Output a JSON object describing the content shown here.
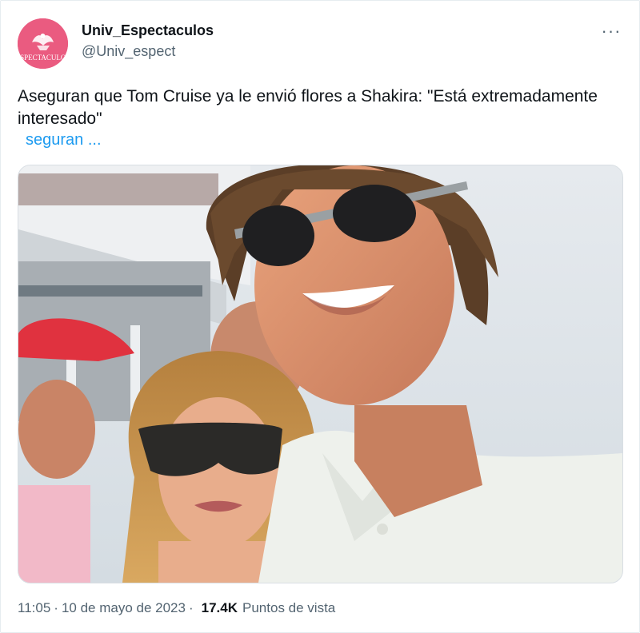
{
  "tweet": {
    "author": {
      "name": "Univ_Espectaculos",
      "handle": "@Univ_espect",
      "avatar_text": "ESPECTACULOS"
    },
    "more_label": "···",
    "text": "Aseguran que Tom Cruise ya le envió flores a Shakira: \"Está extremadamente interesado\"",
    "link_text": "seguran ...",
    "time": "11:05",
    "date": "10 de mayo de 2023",
    "separator": "·",
    "views_count": "17.4K",
    "views_label": "Puntos de vista"
  },
  "colors": {
    "accent": "#1d9bf0",
    "avatar_bg": "#ea5b80",
    "text_primary": "#0f1419",
    "text_secondary": "#536471"
  },
  "icons": {
    "more": "more-horizontal-icon"
  }
}
